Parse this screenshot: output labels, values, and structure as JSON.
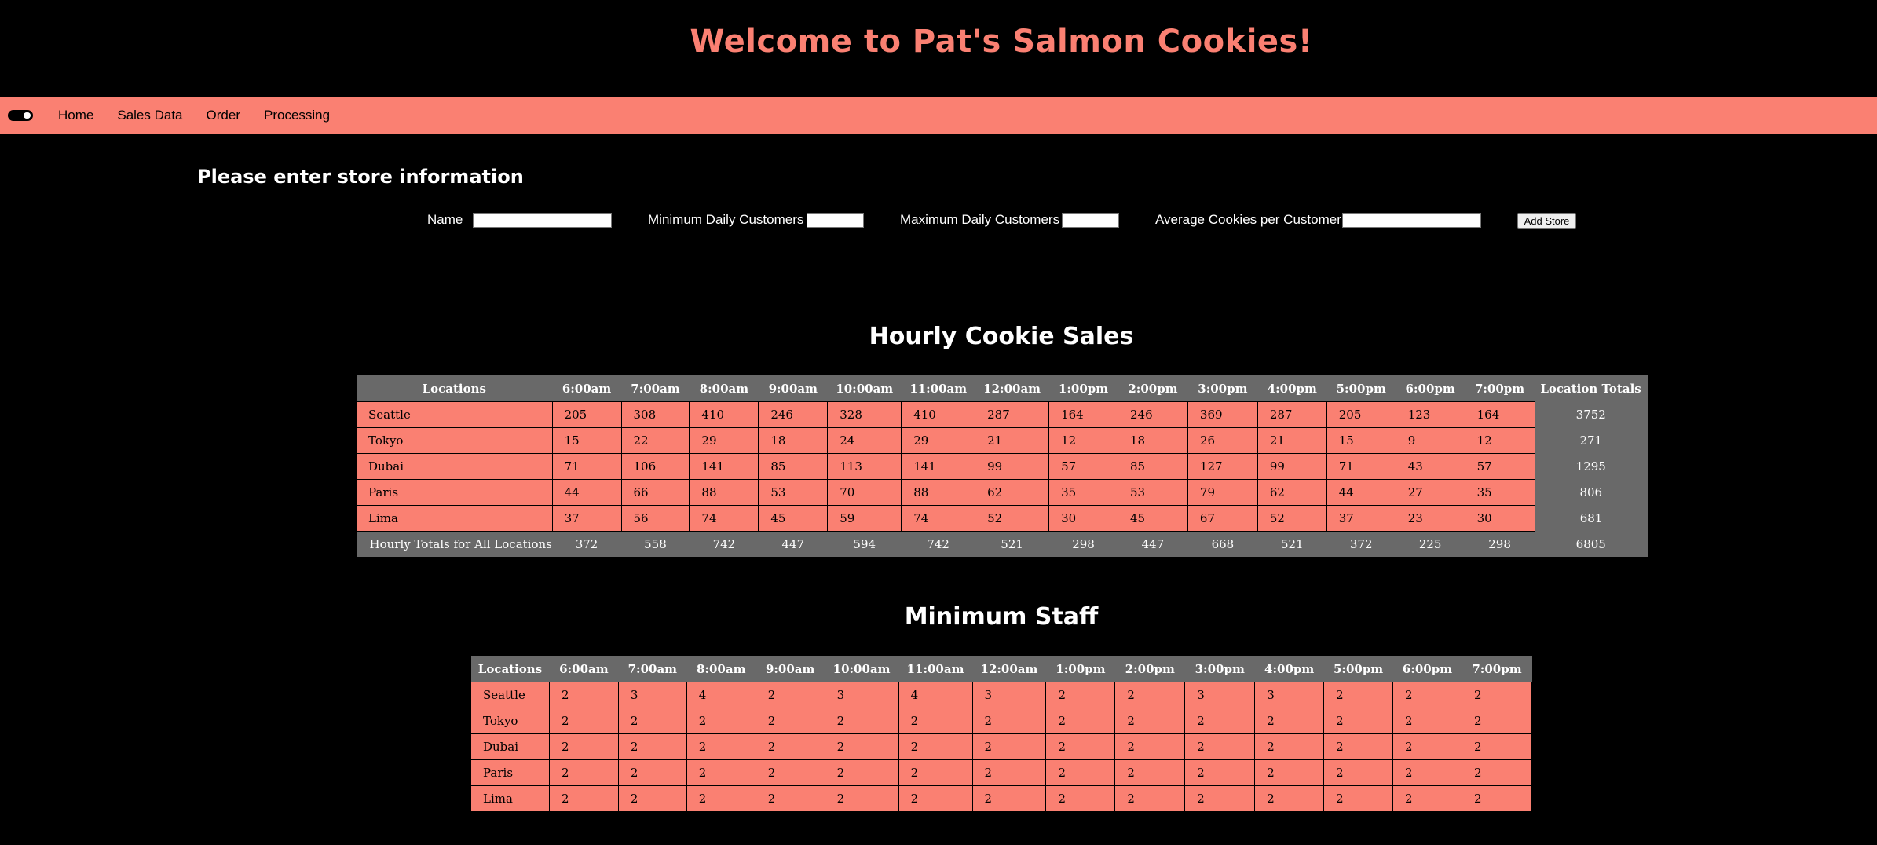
{
  "header": {
    "title": "Welcome to Pat's Salmon Cookies!"
  },
  "nav": {
    "items": [
      {
        "label": "Home"
      },
      {
        "label": "Sales Data"
      },
      {
        "label": "Order"
      },
      {
        "label": "Processing"
      }
    ]
  },
  "form": {
    "heading": "Please enter store information",
    "name_label": "Name",
    "name_value": "",
    "min_label": "Minimum Daily Customers",
    "min_value": "",
    "max_label": "Maximum Daily Customers",
    "max_value": "",
    "avg_label": "Average Cookies per Customer",
    "avg_value": "",
    "submit_label": "Add Store"
  },
  "sales": {
    "title": "Hourly Cookie Sales",
    "headers": [
      "Locations",
      "6:00am",
      "7:00am",
      "8:00am",
      "9:00am",
      "10:00am",
      "11:00am",
      "12:00am",
      "1:00pm",
      "2:00pm",
      "3:00pm",
      "4:00pm",
      "5:00pm",
      "6:00pm",
      "7:00pm",
      "Location Totals"
    ],
    "rows": [
      [
        "Seattle",
        "205",
        "308",
        "410",
        "246",
        "328",
        "410",
        "287",
        "164",
        "246",
        "369",
        "287",
        "205",
        "123",
        "164",
        "3752"
      ],
      [
        "Tokyo",
        "15",
        "22",
        "29",
        "18",
        "24",
        "29",
        "21",
        "12",
        "18",
        "26",
        "21",
        "15",
        "9",
        "12",
        "271"
      ],
      [
        "Dubai",
        "71",
        "106",
        "141",
        "85",
        "113",
        "141",
        "99",
        "57",
        "85",
        "127",
        "99",
        "71",
        "43",
        "57",
        "1295"
      ],
      [
        "Paris",
        "44",
        "66",
        "88",
        "53",
        "70",
        "88",
        "62",
        "35",
        "53",
        "79",
        "62",
        "44",
        "27",
        "35",
        "806"
      ],
      [
        "Lima",
        "37",
        "56",
        "74",
        "45",
        "59",
        "74",
        "52",
        "30",
        "45",
        "67",
        "52",
        "37",
        "23",
        "30",
        "681"
      ]
    ],
    "footer": [
      "Hourly Totals for All Locations",
      "372",
      "558",
      "742",
      "447",
      "594",
      "742",
      "521",
      "298",
      "447",
      "668",
      "521",
      "372",
      "225",
      "298",
      "6805"
    ]
  },
  "staff": {
    "title": "Minimum Staff",
    "headers": [
      "Locations",
      "6:00am",
      "7:00am",
      "8:00am",
      "9:00am",
      "10:00am",
      "11:00am",
      "12:00am",
      "1:00pm",
      "2:00pm",
      "3:00pm",
      "4:00pm",
      "5:00pm",
      "6:00pm",
      "7:00pm"
    ],
    "rows": [
      [
        "Seattle",
        "2",
        "3",
        "4",
        "2",
        "3",
        "4",
        "3",
        "2",
        "2",
        "3",
        "3",
        "2",
        "2",
        "2"
      ],
      [
        "Tokyo",
        "2",
        "2",
        "2",
        "2",
        "2",
        "2",
        "2",
        "2",
        "2",
        "2",
        "2",
        "2",
        "2",
        "2"
      ],
      [
        "Dubai",
        "2",
        "2",
        "2",
        "2",
        "2",
        "2",
        "2",
        "2",
        "2",
        "2",
        "2",
        "2",
        "2",
        "2"
      ],
      [
        "Paris",
        "2",
        "2",
        "2",
        "2",
        "2",
        "2",
        "2",
        "2",
        "2",
        "2",
        "2",
        "2",
        "2",
        "2"
      ],
      [
        "Lima",
        "2",
        "2",
        "2",
        "2",
        "2",
        "2",
        "2",
        "2",
        "2",
        "2",
        "2",
        "2",
        "2",
        "2"
      ]
    ]
  },
  "colors": {
    "accent": "#fa8072",
    "header_bg": "#696969",
    "background": "#000000"
  }
}
